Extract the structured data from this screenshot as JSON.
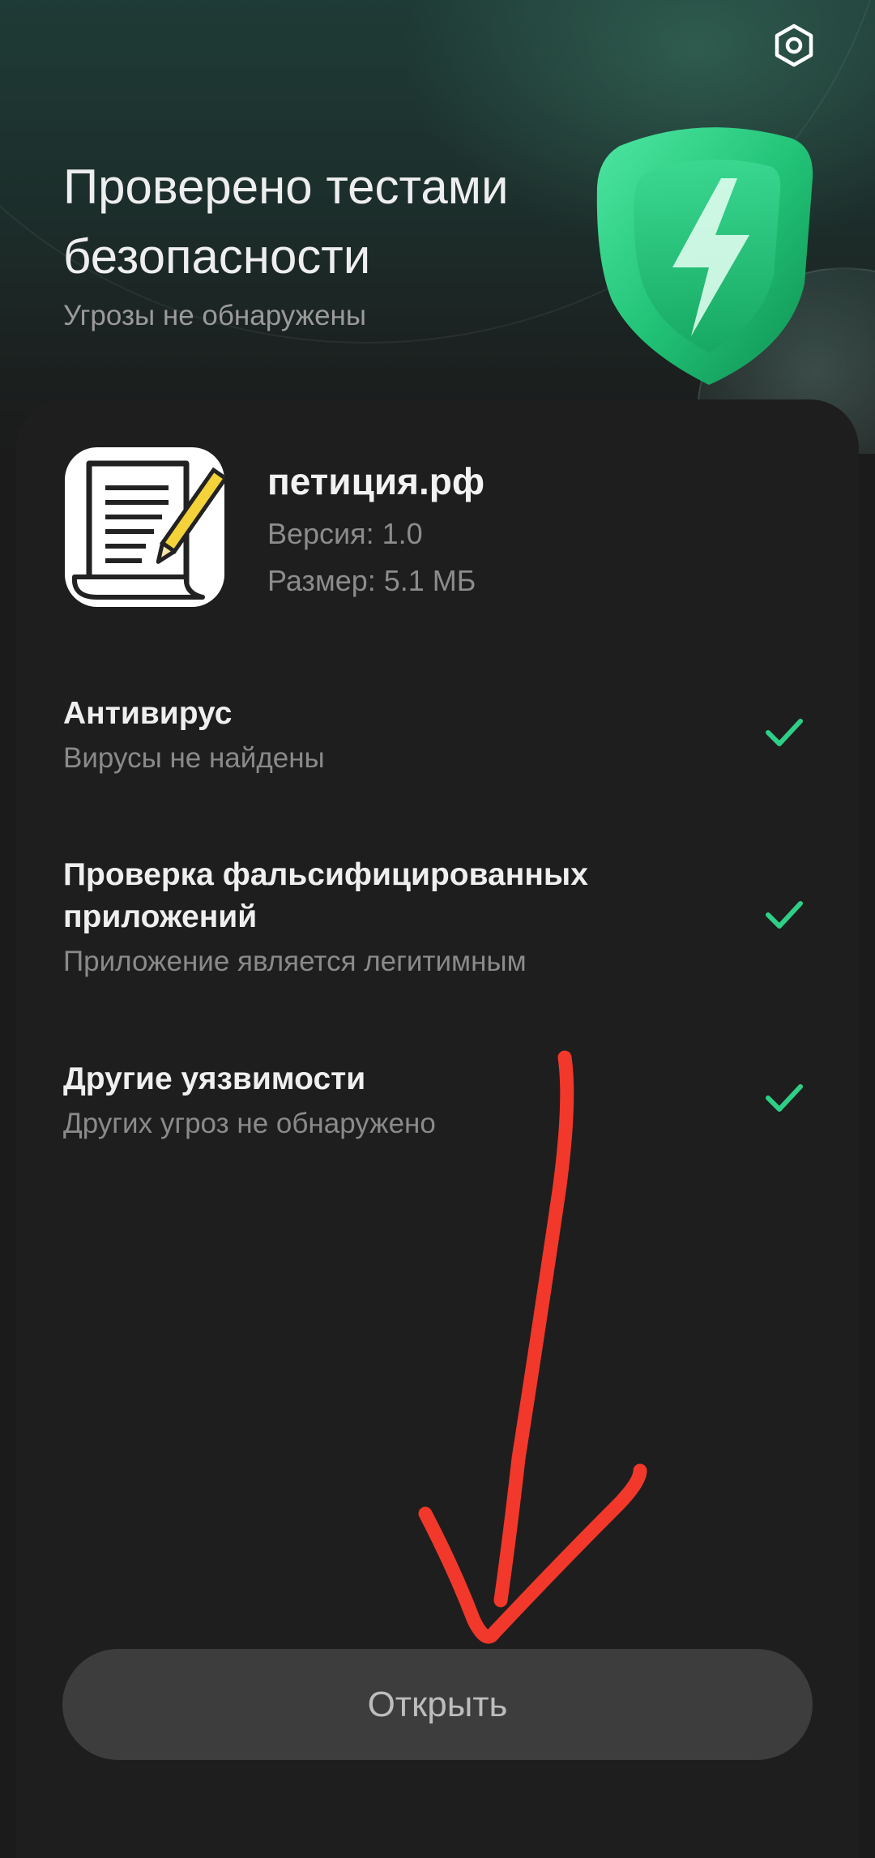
{
  "header": {
    "title": "Проверено тестами безопасности",
    "subtitle": "Угрозы не обнаружены",
    "settings_icon": "settings-hexagon-icon",
    "shield_icon": "shield-lightning-icon",
    "accent_color": "#2ecf86"
  },
  "app": {
    "name": "петиция.рф",
    "version": "Версия: 1.0",
    "size": "Размер: 5.1 МБ",
    "icon": "document-pencil-icon"
  },
  "checks": [
    {
      "title": "Антивирус",
      "subtitle": "Вирусы не найдены",
      "status_icon": "check-icon"
    },
    {
      "title": "Проверка фальсифицированных приложений",
      "subtitle": "Приложение является легитимным",
      "status_icon": "check-icon"
    },
    {
      "title": "Другие уязвимости",
      "subtitle": "Других угроз не обнаружено",
      "status_icon": "check-icon"
    }
  ],
  "annotation": {
    "icon": "red-arrow-annotation",
    "color": "#f2382b"
  },
  "footer": {
    "open_label": "Открыть"
  }
}
